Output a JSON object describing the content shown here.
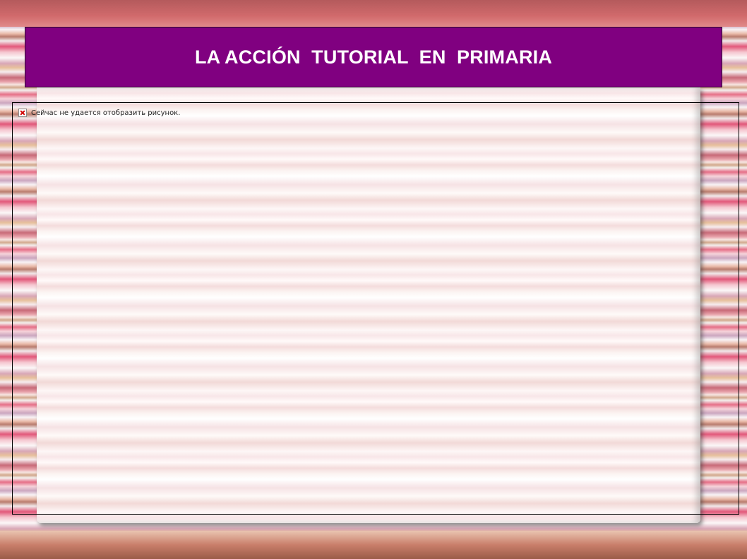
{
  "slide": {
    "title": "LA ACCIÓN  TUTORIAL  EN  PRIMARIA",
    "title_bg_color": "#800080",
    "title_text_color": "#ffffff"
  },
  "image_placeholder": {
    "message": "Сейчас не удается отобразить рисунок.",
    "icon": "broken-image-icon"
  }
}
